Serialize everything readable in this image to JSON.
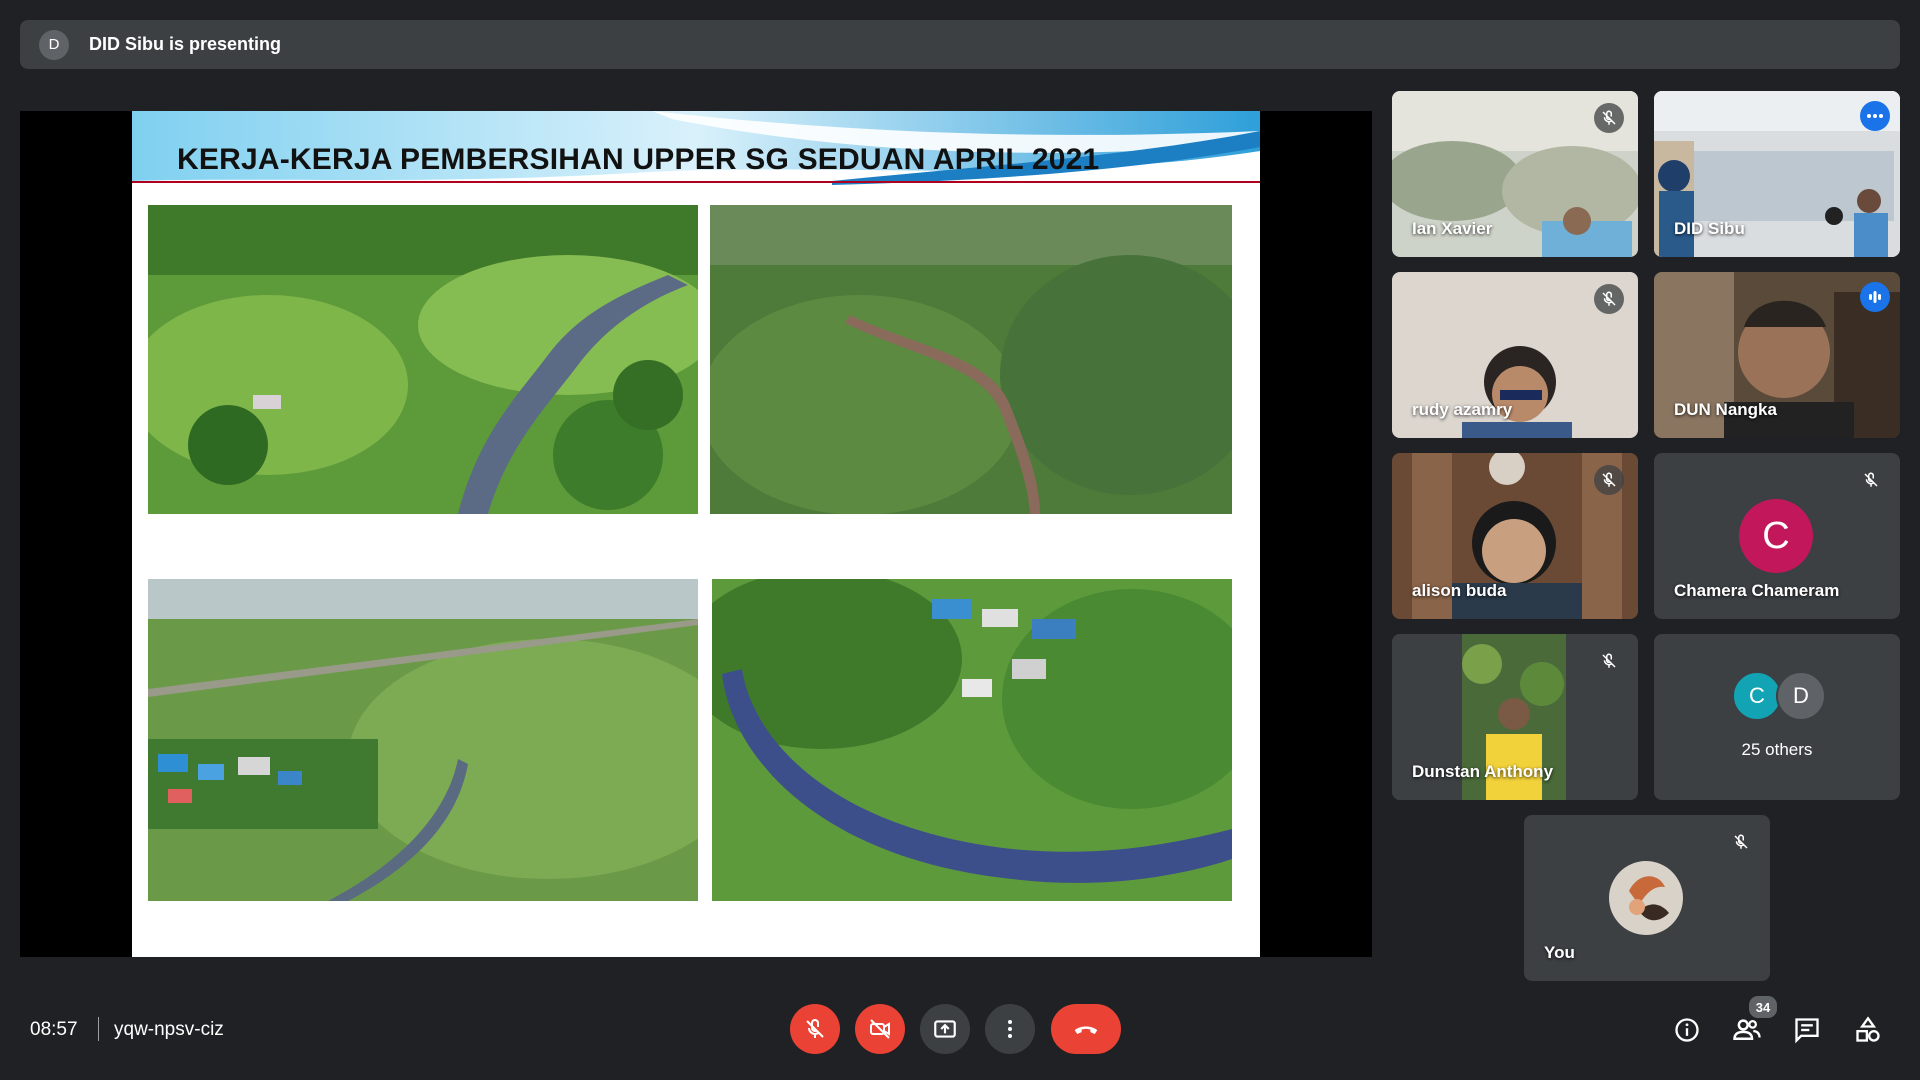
{
  "presenting_banner": {
    "avatar_letter": "D",
    "text": "DID Sibu is presenting"
  },
  "slide": {
    "title": "KERJA-KERJA PEMBERSIHAN UPPER SG SEDUAN APRIL 2021"
  },
  "participants": [
    {
      "name": "Ian Xavier",
      "muted": true
    },
    {
      "name": "DID Sibu",
      "muted": false,
      "active": true,
      "indicator": "more-options-icon"
    },
    {
      "name": "rudy azamry",
      "muted": true
    },
    {
      "name": "DUN Nangka",
      "muted": false,
      "indicator": "speaking-icon"
    },
    {
      "name": "alison buda",
      "muted": true
    },
    {
      "name": "Chamera Chameram",
      "muted": true,
      "avatar_letter": "C",
      "avatar_color": "#c2185b"
    },
    {
      "name": "Dunstan Anthony",
      "muted": true
    }
  ],
  "others_tile": {
    "avatars": [
      {
        "letter": "C",
        "color": "#12a4b5"
      },
      {
        "letter": "D",
        "color": "#5f6368"
      }
    ],
    "label": "25 others"
  },
  "self_tile": {
    "name": "You",
    "muted": true
  },
  "bottom_bar": {
    "time": "08:57",
    "meeting_code": "yqw-npsv-ciz",
    "participant_count": "34",
    "controls": [
      "mic-off-icon",
      "camera-off-icon",
      "present-icon",
      "more-vert-icon",
      "end-call-icon"
    ],
    "right_icons": [
      "info-icon",
      "people-icon",
      "chat-icon",
      "activities-icon"
    ]
  },
  "colors": {
    "background": "#202124",
    "tile": "#3c4043",
    "accent": "#8ab4f8",
    "danger": "#ea4335",
    "speaking": "#1a73e8"
  }
}
